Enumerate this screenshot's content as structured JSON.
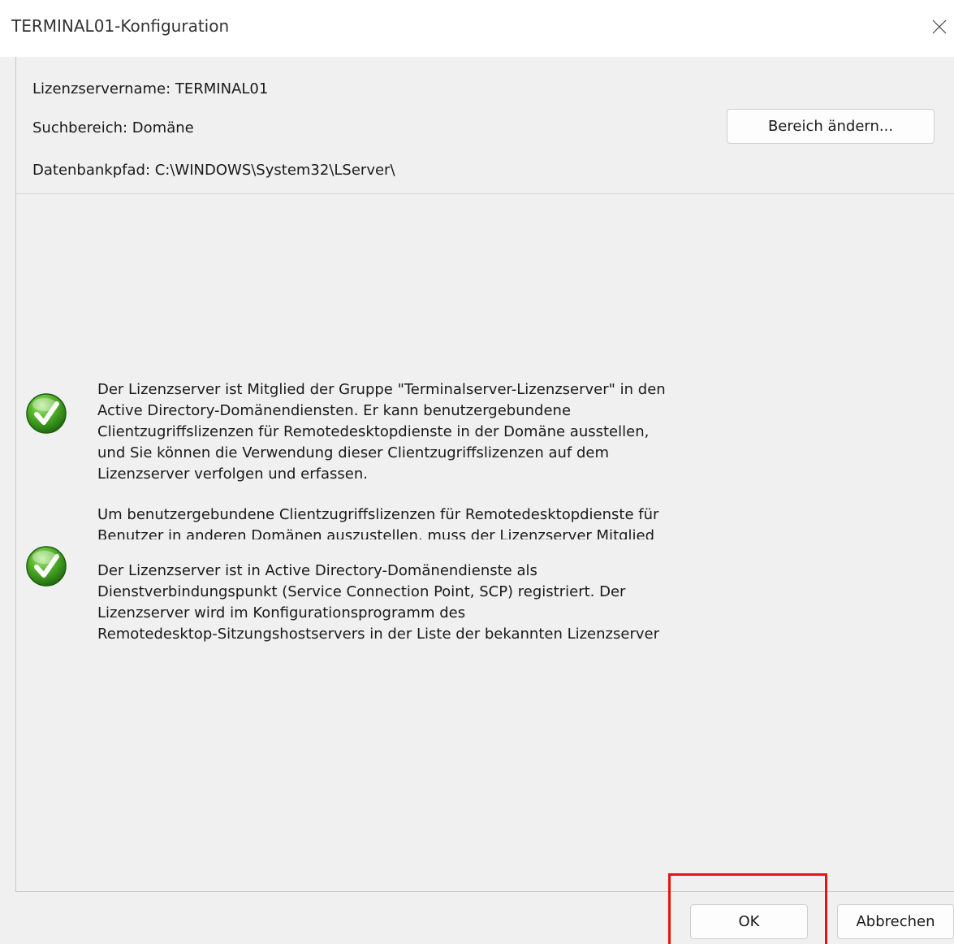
{
  "window": {
    "title": "TERMINAL01-Konfiguration",
    "close_icon": "close-icon"
  },
  "info": {
    "server_name": "Lizenzservername: TERMINAL01",
    "search_scope": "Suchbereich: Domäne",
    "change_scope_button": "Bereich ändern...",
    "database_path": "Datenbankpfad: C:\\WINDOWS\\System32\\LServer\\"
  },
  "status_items": [
    {
      "icon": "check-icon",
      "paragraphs": [
        "Der Lizenzserver ist Mitglied der Gruppe \"Terminalserver-Lizenzserver\" in den\nActive Directory-Domänendiensten. Er kann benutzergebundene\nClientzugriffslizenzen für Remotedesktopdienste in der Domäne ausstellen,\nund Sie können die Verwendung dieser Clientzugriffslizenzen auf dem\nLizenzserver verfolgen und erfassen.",
        "Um benutzergebundene Clientzugriffslizenzen für Remotedesktopdienste für\nBenutzer in anderen Domänen auszustellen, muss der Lizenzserver Mitglied"
      ]
    },
    {
      "icon": "check-icon",
      "paragraphs": [
        "Der Lizenzserver ist in Active Directory-Domänendienste als\nDienstverbindungspunkt (Service Connection Point, SCP) registriert. Der\nLizenzserver wird im Konfigurationsprogramm des\nRemotedesktop-Sitzungshostservers in der Liste der bekannten Lizenzserver"
      ]
    }
  ],
  "buttons": {
    "ok": "OK",
    "cancel": "Abbrechen"
  },
  "colors": {
    "highlight": "#e01515",
    "check_green": "#3f9b1f"
  }
}
